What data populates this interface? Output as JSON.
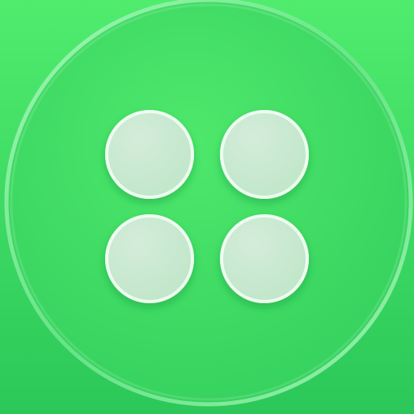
{
  "icon": {
    "name": "four-dot-grid-icon",
    "shape": "circular button with four frosted circles in a 2x2 grid",
    "colors": {
      "background_top": "#50ec6e",
      "background_bottom": "#2bc859",
      "ring": "#b9ffc9",
      "dot_fill": "#e4f2e8",
      "dot_rim": "#f3fff6",
      "dot_shadow": "#17953c"
    }
  }
}
